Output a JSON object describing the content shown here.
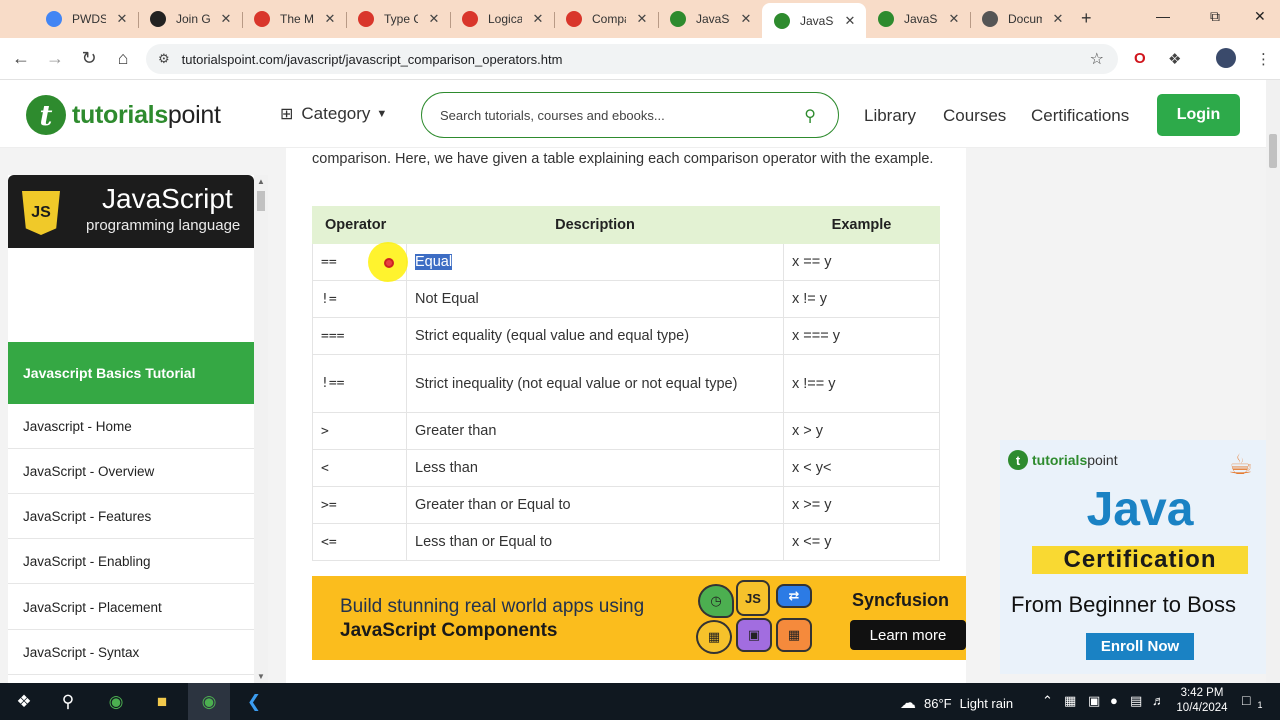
{
  "browser": {
    "tabs": [
      {
        "label": "PWDS-",
        "icon": "google-drive-icon",
        "color": "#4285f4"
      },
      {
        "label": "Join Gi",
        "icon": "graduation-cap-icon",
        "color": "#222222"
      },
      {
        "label": "The Mc",
        "icon": "figure-icon",
        "color": "#d9362b"
      },
      {
        "label": "Type C",
        "icon": "figure-icon",
        "color": "#d9362b"
      },
      {
        "label": "Logical",
        "icon": "figure-icon",
        "color": "#d9362b"
      },
      {
        "label": "Compa",
        "icon": "figure-icon",
        "color": "#d9362b"
      },
      {
        "label": "JavaScr",
        "icon": "tutorialspoint-icon",
        "color": "#2e8b2e"
      },
      {
        "label": "JavaScr",
        "icon": "tutorialspoint-icon",
        "color": "#2e8b2e",
        "active": true
      },
      {
        "label": "JavaScr",
        "icon": "tutorialspoint-icon",
        "color": "#2e8b2e"
      },
      {
        "label": "Docum",
        "icon": "globe-icon",
        "color": "#555555"
      }
    ],
    "url": "tutorialspoint.com/javascript/javascript_comparison_operators.htm"
  },
  "site": {
    "logo_main": "tutorials",
    "logo_accent": "point",
    "category_label": "Category",
    "search_placeholder": "Search tutorials, courses and ebooks...",
    "nav": [
      "Library",
      "Courses",
      "Certifications"
    ],
    "login_label": "Login",
    "brand_color": "#2e8b2e"
  },
  "sidebar": {
    "banner_title": "JavaScript",
    "banner_subtitle": "programming language",
    "shield_text": "JS",
    "section_title": "Javascript Basics Tutorial",
    "items": [
      "Javascript - Home",
      "JavaScript - Overview",
      "JavaScript - Features",
      "JavaScript - Enabling",
      "JavaScript - Placement",
      "JavaScript - Syntax"
    ]
  },
  "content": {
    "intro": "comparison. Here, we have given a table explaining each comparison operator with the example.",
    "table": {
      "headers": [
        "Operator",
        "Description",
        "Example"
      ],
      "rows": [
        {
          "op": "==",
          "desc": "Equal",
          "ex": "x == y",
          "highlight": true
        },
        {
          "op": "!=",
          "desc": "Not Equal",
          "ex": "x != y"
        },
        {
          "op": "===",
          "desc": "Strict equality (equal value and equal type)",
          "ex": "x === y"
        },
        {
          "op": "!==",
          "desc": "Strict inequality (not equal value or not equal type)",
          "ex": "x !== y"
        },
        {
          "op": ">",
          "desc": "Greater than",
          "ex": "x > y"
        },
        {
          "op": "<",
          "desc": "Less than",
          "ex": "x < y<"
        },
        {
          "op": ">=",
          "desc": "Greater than or Equal to",
          "ex": "x >= y"
        },
        {
          "op": "<=",
          "desc": "Less than or Equal to",
          "ex": "x <= y"
        }
      ]
    },
    "ad_banner": {
      "line1": "Build stunning real world apps using",
      "line2": "JavaScript Components",
      "chip_text": "JS",
      "brand": "Syncfusion",
      "cta": "Learn more"
    }
  },
  "side_ad": {
    "logo_main": "tutorials",
    "logo_accent": "point",
    "title": "Java",
    "badge": "Certification",
    "tagline": "From Beginner to Boss",
    "cta": "Enroll Now"
  },
  "taskbar": {
    "weather_temp": "86°F",
    "weather_desc": "Light rain",
    "time": "3:42 PM",
    "date": "10/4/2024",
    "notification_count": "1"
  }
}
